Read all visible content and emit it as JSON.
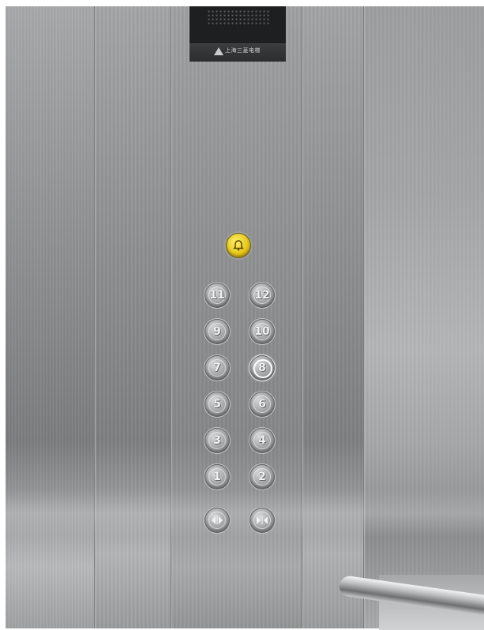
{
  "scene": {
    "brand_plate_text": "上海三菱电梯",
    "alarm_button": {
      "icon": "bell-icon",
      "color": "#e7c81b"
    },
    "floor_buttons": [
      {
        "label": "11",
        "lit": false
      },
      {
        "label": "12",
        "lit": false
      },
      {
        "label": "9",
        "lit": false
      },
      {
        "label": "10",
        "lit": false
      },
      {
        "label": "7",
        "lit": false
      },
      {
        "label": "8",
        "lit": true
      },
      {
        "label": "5",
        "lit": false
      },
      {
        "label": "6",
        "lit": false
      },
      {
        "label": "3",
        "lit": false
      },
      {
        "label": "4",
        "lit": false
      },
      {
        "label": "1",
        "lit": false
      },
      {
        "label": "2",
        "lit": false
      }
    ],
    "door_buttons": [
      {
        "icon": "door-open-icon"
      },
      {
        "icon": "door-close-icon"
      }
    ]
  }
}
